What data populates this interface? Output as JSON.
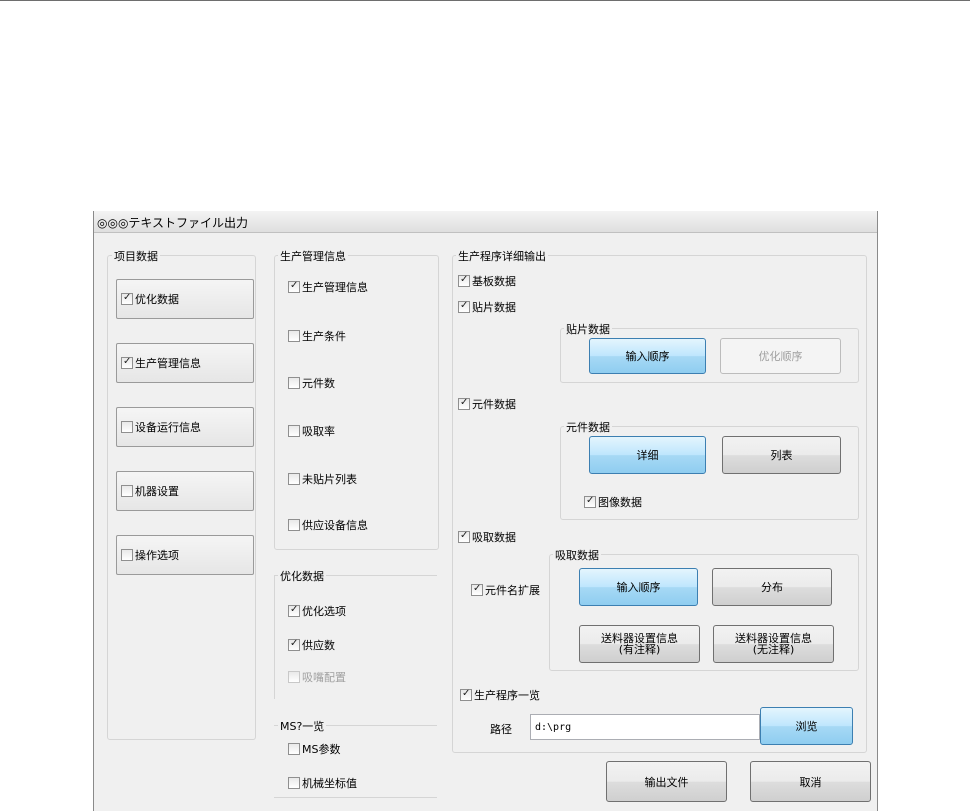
{
  "window": {
    "title": "◎◎◎テキストファイル出力"
  },
  "project_data": {
    "group_label": "项目数据",
    "items": [
      {
        "label": "优化数据",
        "checked": true
      },
      {
        "label": "生产管理信息",
        "checked": true
      },
      {
        "label": "设备运行信息",
        "checked": false
      },
      {
        "label": "机器设置",
        "checked": false
      },
      {
        "label": "操作选项",
        "checked": false
      }
    ]
  },
  "production_info": {
    "group_label": "生产管理信息",
    "items": [
      {
        "label": "生产管理信息",
        "checked": true
      },
      {
        "label": "生产条件",
        "checked": false
      },
      {
        "label": "元件数",
        "checked": false
      },
      {
        "label": "吸取率",
        "checked": false
      },
      {
        "label": "未贴片列表",
        "checked": false
      },
      {
        "label": "供应设备信息",
        "checked": false
      }
    ]
  },
  "optimize_data": {
    "group_label": "优化数据",
    "items": [
      {
        "label": "优化选项",
        "checked": true
      },
      {
        "label": "供应数",
        "checked": true
      },
      {
        "label": "吸嘴配置",
        "checked": false,
        "disabled": true
      }
    ]
  },
  "ms_list": {
    "group_label": "MS?一览",
    "items": [
      {
        "label": "MS参数",
        "checked": false
      },
      {
        "label": "机械坐标值",
        "checked": false
      }
    ]
  },
  "program_detail": {
    "group_label": "生产程序详细输出",
    "board": {
      "label": "基板数据",
      "checked": true
    },
    "mount": {
      "label": "贴片数据",
      "checked": true
    },
    "mount_group": {
      "label": "贴片数据",
      "input_order": "输入顺序",
      "optimize_order": "优化顺序"
    },
    "component": {
      "label": "元件数据",
      "checked": true
    },
    "component_group": {
      "label": "元件数据",
      "detail": "详细",
      "list": "列表",
      "image": "图像数据",
      "image_checked": true
    },
    "pickup": {
      "label": "吸取数据",
      "checked": true
    },
    "pickup_group": {
      "label": "吸取数据",
      "ext": "元件名扩展",
      "ext_checked": true,
      "input_order": "输入顺序",
      "distribution": "分布",
      "feeder_with_1": "送料器设置信息",
      "feeder_with_2": "(有注释)",
      "feeder_without_1": "送料器设置信息",
      "feeder_without_2": "(无注释)"
    },
    "program_list": {
      "label": "生产程序一览",
      "checked": true
    },
    "path": {
      "label": "路径",
      "value": "d:\\prg",
      "browse": "浏览"
    }
  },
  "footer": {
    "output": "输出文件",
    "cancel": "取消"
  }
}
